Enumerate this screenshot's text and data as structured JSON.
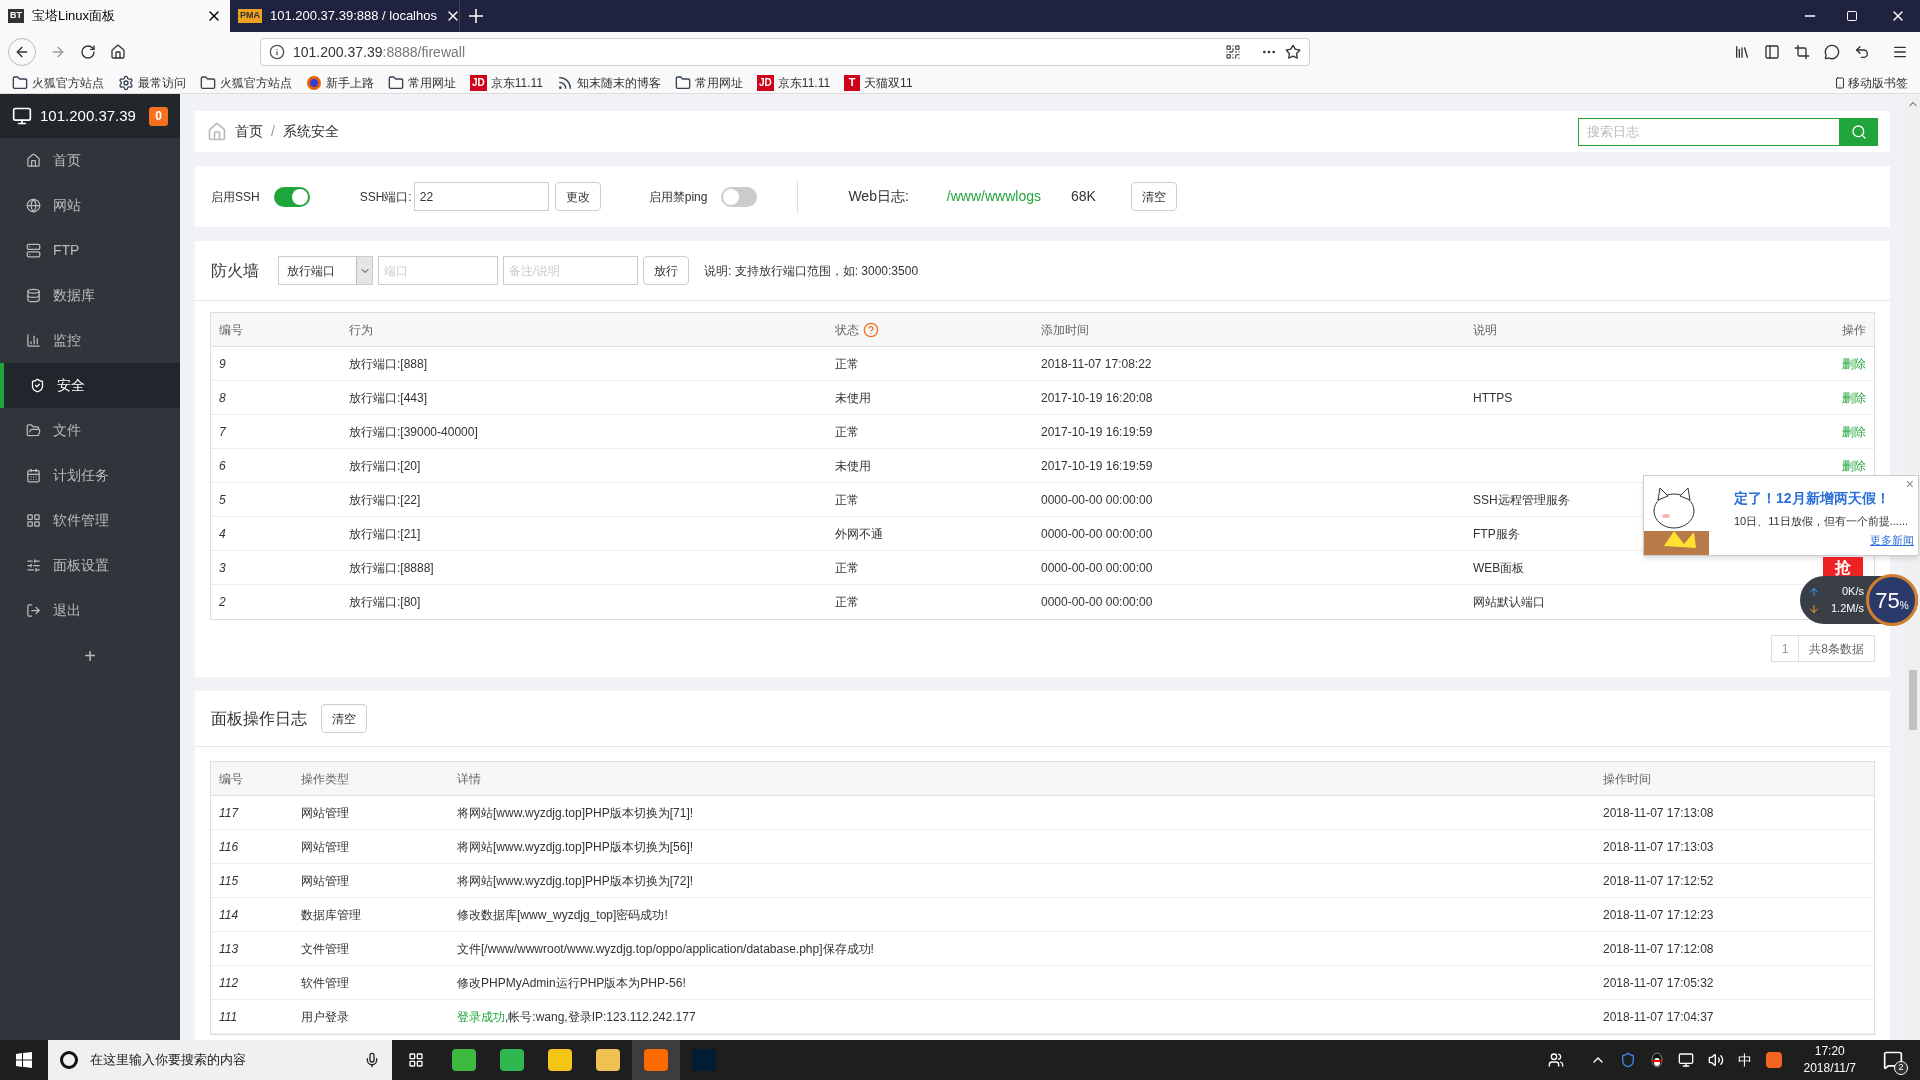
{
  "browser": {
    "tabs": [
      {
        "title": "宝塔Linux面板",
        "favicon": "BT",
        "selected": true
      },
      {
        "title": "101.200.37.39:888 / localhos",
        "favicon": "PMA",
        "selected": false
      }
    ],
    "url": {
      "host": "101.200.37.39",
      "path": ":8888/firewall"
    },
    "bookmarks": [
      {
        "kind": "folder",
        "label": "火狐官方站点"
      },
      {
        "kind": "gear",
        "label": "最常访问"
      },
      {
        "kind": "folder",
        "label": "火狐官方站点"
      },
      {
        "kind": "firefox",
        "label": "新手上路"
      },
      {
        "kind": "folder",
        "label": "常用网址"
      },
      {
        "kind": "jd",
        "label": "京东11.11",
        "badge": "JD"
      },
      {
        "kind": "rss",
        "label": "知末随末的博客"
      },
      {
        "kind": "folder",
        "label": "常用网址"
      },
      {
        "kind": "jd",
        "label": "京东11.11",
        "badge": "JD"
      },
      {
        "kind": "tmall",
        "label": "天猫双11",
        "badge": "T"
      }
    ],
    "mobile_bookmarks": "移动版书签"
  },
  "sidebar": {
    "server": "101.200.37.39",
    "badge": "0",
    "items": [
      {
        "label": "首页",
        "selected": false
      },
      {
        "label": "网站",
        "selected": false
      },
      {
        "label": "FTP",
        "selected": false
      },
      {
        "label": "数据库",
        "selected": false
      },
      {
        "label": "监控",
        "selected": false
      },
      {
        "label": "安全",
        "selected": true
      },
      {
        "label": "文件",
        "selected": false
      },
      {
        "label": "计划任务",
        "selected": false
      },
      {
        "label": "软件管理",
        "selected": false
      },
      {
        "label": "面板设置",
        "selected": false
      },
      {
        "label": "退出",
        "selected": false
      }
    ],
    "add": "+"
  },
  "breadcrumb": [
    "首页",
    "系统安全"
  ],
  "breadcrumb_separator": "/",
  "search": {
    "placeholder": "搜索日志"
  },
  "ssh": {
    "label": "启用SSH",
    "on": true,
    "port_label": "SSH端口:",
    "port": "22",
    "change": "更改",
    "ping_label": "启用禁ping",
    "ping_on": false,
    "weblog_label": "Web日志:",
    "weblog_path": "/www/wwwlogs",
    "weblog_size": "68K",
    "clear": "清空"
  },
  "firewall": {
    "title": "防火墙",
    "select": "放行端口",
    "port_placeholder": "端口",
    "note_placeholder": "备注/说明",
    "submit": "放行",
    "hint": "说明: 支持放行端口范围，如: 3000:3500",
    "columns": [
      "编号",
      "行为",
      "状态",
      "添加时间",
      "说明",
      "操作"
    ],
    "rows": [
      {
        "id": "9",
        "action": "放行端口:[888]",
        "status": "正常",
        "time": "2018-11-07 17:08:22",
        "note": "",
        "op": "删除"
      },
      {
        "id": "8",
        "action": "放行端口:[443]",
        "status": "未使用",
        "time": "2017-10-19 16:20:08",
        "note": "HTTPS",
        "op": "删除"
      },
      {
        "id": "7",
        "action": "放行端口:[39000-40000]",
        "status": "正常",
        "time": "2017-10-19 16:19:59",
        "note": "",
        "op": "删除"
      },
      {
        "id": "6",
        "action": "放行端口:[20]",
        "status": "未使用",
        "time": "2017-10-19 16:19:59",
        "note": "",
        "op": "删除"
      },
      {
        "id": "5",
        "action": "放行端口:[22]",
        "status": "正常",
        "time": "0000-00-00 00:00:00",
        "note": "SSH远程管理服务",
        "op": ""
      },
      {
        "id": "4",
        "action": "放行端口:[21]",
        "status": "外网不通",
        "time": "0000-00-00 00:00:00",
        "note": "FTP服务",
        "op": ""
      },
      {
        "id": "3",
        "action": "放行端口:[8888]",
        "status": "正常",
        "time": "0000-00-00 00:00:00",
        "note": "WEB面板",
        "op": ""
      },
      {
        "id": "2",
        "action": "放行端口:[80]",
        "status": "正常",
        "time": "0000-00-00 00:00:00",
        "note": "网站默认端口",
        "op": ""
      }
    ],
    "page": "1",
    "total": "共8条数据"
  },
  "log": {
    "title": "面板操作日志",
    "clear": "清空",
    "columns": [
      "编号",
      "操作类型",
      "详情",
      "操作时间"
    ],
    "rows": [
      {
        "id": "117",
        "type": "网站管理",
        "highlight": "",
        "detail": "将网站[www.wyzdjg.top]PHP版本切换为[71]!",
        "time": "2018-11-07 17:13:08"
      },
      {
        "id": "116",
        "type": "网站管理",
        "highlight": "",
        "detail": "将网站[www.wyzdjg.top]PHP版本切换为[56]!",
        "time": "2018-11-07 17:13:03"
      },
      {
        "id": "115",
        "type": "网站管理",
        "highlight": "",
        "detail": "将网站[www.wyzdjg.top]PHP版本切换为[72]!",
        "time": "2018-11-07 17:12:52"
      },
      {
        "id": "114",
        "type": "数据库管理",
        "highlight": "",
        "detail": "修改数据库[www_wyzdjg_top]密码成功!",
        "time": "2018-11-07 17:12:23"
      },
      {
        "id": "113",
        "type": "文件管理",
        "highlight": "",
        "detail": "文件[/www/wwwroot/www.wyzdjg.top/oppo/application/database.php]保存成功!",
        "time": "2018-11-07 17:12:08"
      },
      {
        "id": "112",
        "type": "软件管理",
        "highlight": "",
        "detail": "修改PHPMyAdmin运行PHP版本为PHP-56!",
        "time": "2018-11-07 17:05:32"
      },
      {
        "id": "111",
        "type": "用户登录",
        "highlight": "登录成功",
        "detail": ",帐号:wang,登录IP:123.112.242.177",
        "time": "2018-11-07 17:04:37"
      }
    ]
  },
  "news_popup": {
    "title": "定了！12月新增两天假！",
    "body": "10日、11日放假，但有一个前提......",
    "link": "更多新闻",
    "close": "×"
  },
  "speed_widget": {
    "grab": "抢",
    "up": "0K/s",
    "down": "1.2M/s",
    "percent": "75",
    "unit": "%"
  },
  "taskbar": {
    "search_placeholder": "在这里输入你要搜索的内容",
    "input_method": "中",
    "time": "17:20",
    "date": "2018/11/7",
    "notifications": "2"
  }
}
